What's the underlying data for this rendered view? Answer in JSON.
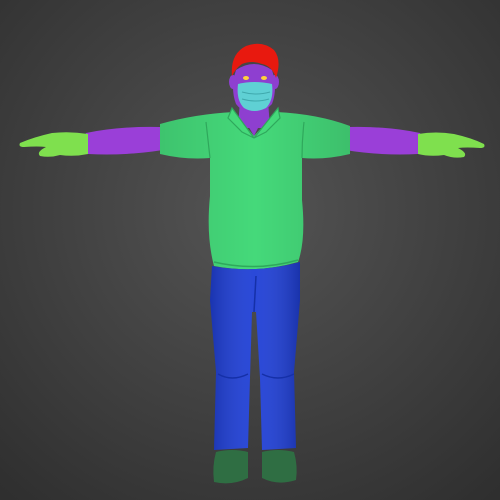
{
  "scene": {
    "kind": "3d-viewport-render",
    "background": {
      "top_color": "#545454",
      "bottom_color": "#2f2f2f"
    },
    "model": {
      "pose": "T-pose",
      "view": "front",
      "parts": {
        "hair": "#e8190f",
        "skin": "#8e3fd0",
        "eyes": "#ffd23a",
        "mask": "#5fd0d4",
        "shirt": "#45d97a",
        "sleeves": "#9a3fd8",
        "hands": "#7fe04e",
        "pants": "#1f3fd6",
        "shoes": "#2f6e43"
      }
    }
  }
}
